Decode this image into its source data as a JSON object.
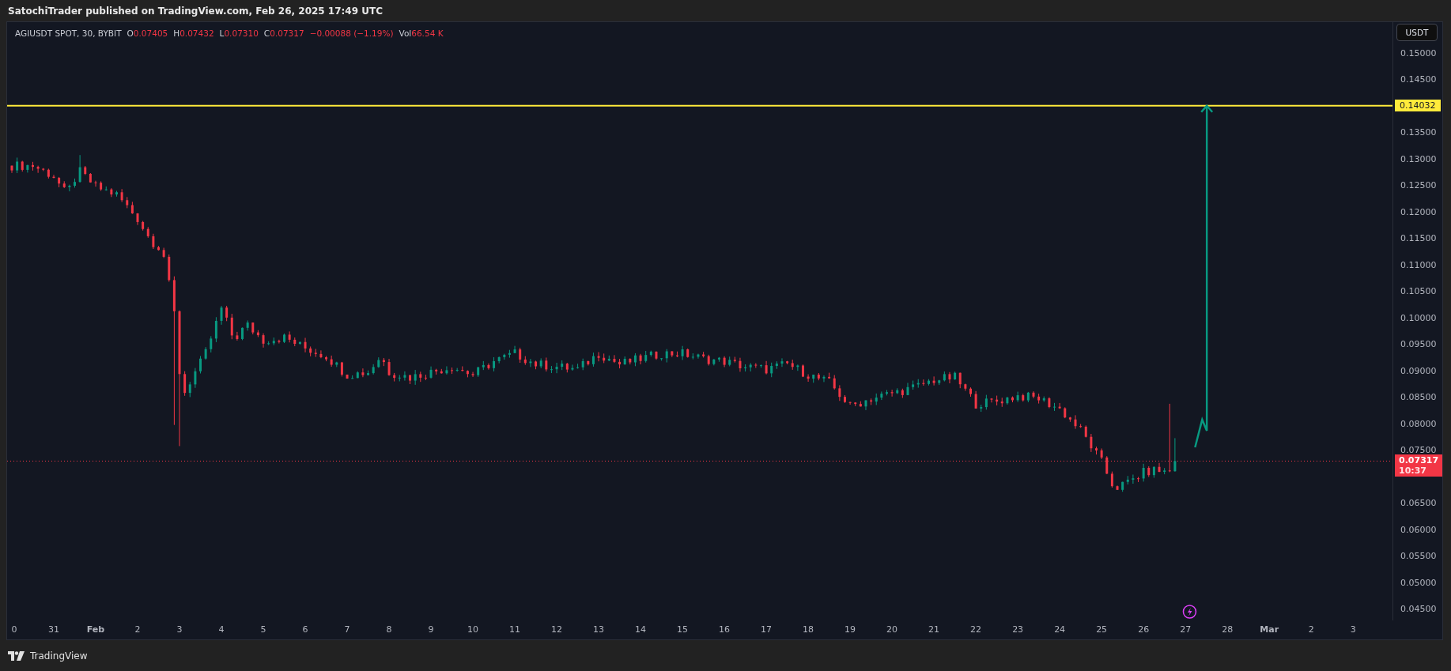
{
  "header": {
    "title": "SatochiTrader published on TradingView.com, Feb 26, 2025 17:49 UTC"
  },
  "legend": {
    "symbol": "AGIUSDT SPOT, 30, BYBIT",
    "fields": [
      {
        "label": "O",
        "value": "0.07405"
      },
      {
        "label": "H",
        "value": "0.07432"
      },
      {
        "label": "L",
        "value": "0.07310"
      },
      {
        "label": "C",
        "value": "0.07317"
      }
    ],
    "change": "−0.00088 (−1.19%)",
    "volume": {
      "label": "Vol",
      "value": "66.54 K"
    }
  },
  "currency_button": "USDT",
  "price_axis": [
    "0.15000",
    "0.14500",
    "0.13500",
    "0.13000",
    "0.12500",
    "0.12000",
    "0.11500",
    "0.11000",
    "0.10500",
    "0.10000",
    "0.09500",
    "0.09000",
    "0.08500",
    "0.08000",
    "0.07500",
    "0.06500",
    "0.06000",
    "0.05500",
    "0.05000",
    "0.04500"
  ],
  "horizontal_line": {
    "label": "0.14032"
  },
  "last_price": {
    "price": "0.07317",
    "countdown": "10:37"
  },
  "time_axis": [
    {
      "label": "0",
      "bold": false
    },
    {
      "label": "31",
      "bold": false
    },
    {
      "label": "Feb",
      "bold": true
    },
    {
      "label": "2",
      "bold": false
    },
    {
      "label": "3",
      "bold": false
    },
    {
      "label": "4",
      "bold": false
    },
    {
      "label": "5",
      "bold": false
    },
    {
      "label": "6",
      "bold": false
    },
    {
      "label": "7",
      "bold": false
    },
    {
      "label": "8",
      "bold": false
    },
    {
      "label": "9",
      "bold": false
    },
    {
      "label": "10",
      "bold": false
    },
    {
      "label": "11",
      "bold": false
    },
    {
      "label": "12",
      "bold": false
    },
    {
      "label": "13",
      "bold": false
    },
    {
      "label": "14",
      "bold": false
    },
    {
      "label": "15",
      "bold": false
    },
    {
      "label": "16",
      "bold": false
    },
    {
      "label": "17",
      "bold": false
    },
    {
      "label": "18",
      "bold": false
    },
    {
      "label": "19",
      "bold": false
    },
    {
      "label": "20",
      "bold": false
    },
    {
      "label": "21",
      "bold": false
    },
    {
      "label": "22",
      "bold": false
    },
    {
      "label": "23",
      "bold": false
    },
    {
      "label": "24",
      "bold": false
    },
    {
      "label": "25",
      "bold": false
    },
    {
      "label": "26",
      "bold": false
    },
    {
      "label": "27",
      "bold": false
    },
    {
      "label": "28",
      "bold": false
    },
    {
      "label": "Mar",
      "bold": true
    },
    {
      "label": "2",
      "bold": false
    },
    {
      "label": "3",
      "bold": false
    }
  ],
  "footer": {
    "brand": "TradingView"
  }
}
